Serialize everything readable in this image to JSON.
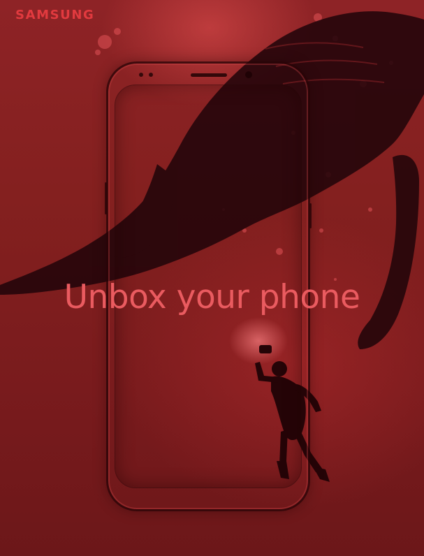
{
  "brand": {
    "logo_text": "SAMSUNG"
  },
  "headline": {
    "text": "Unbox your phone"
  },
  "artwork": {
    "background_color": "#8e2326",
    "accent_color": "#ea5b60",
    "brand_color": "#e23a3f",
    "silhouette_color": "#1f0406",
    "subjects": [
      "whale-silhouette",
      "scuba-diver",
      "smartphone-outline"
    ]
  }
}
